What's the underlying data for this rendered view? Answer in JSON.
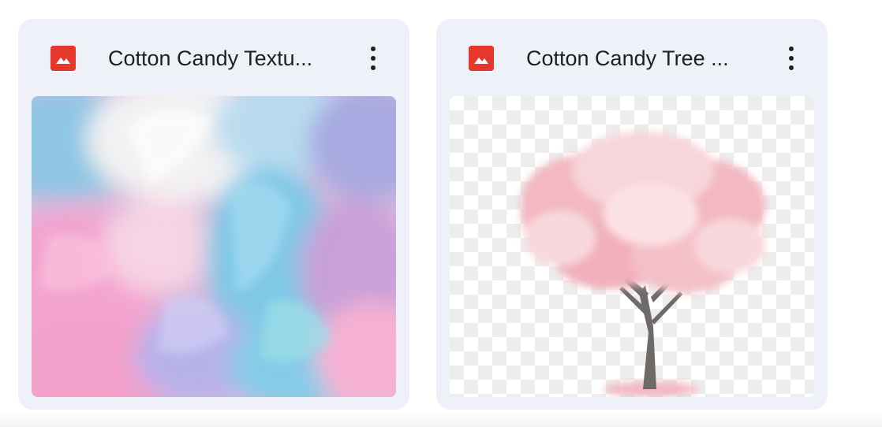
{
  "files": [
    {
      "title": "Cotton Candy Textu...",
      "icon": "image-file-icon",
      "menu_icon": "more-vert-icon",
      "thumbnail": "cotton-candy-texture-image"
    },
    {
      "title": "Cotton Candy Tree ...",
      "icon": "image-file-icon",
      "menu_icon": "more-vert-icon",
      "thumbnail": "cotton-candy-tree-image"
    }
  ],
  "colors": {
    "card_background": "#eef2f8",
    "image_icon": "#e5372b",
    "title_text": "#1f1f1f"
  }
}
